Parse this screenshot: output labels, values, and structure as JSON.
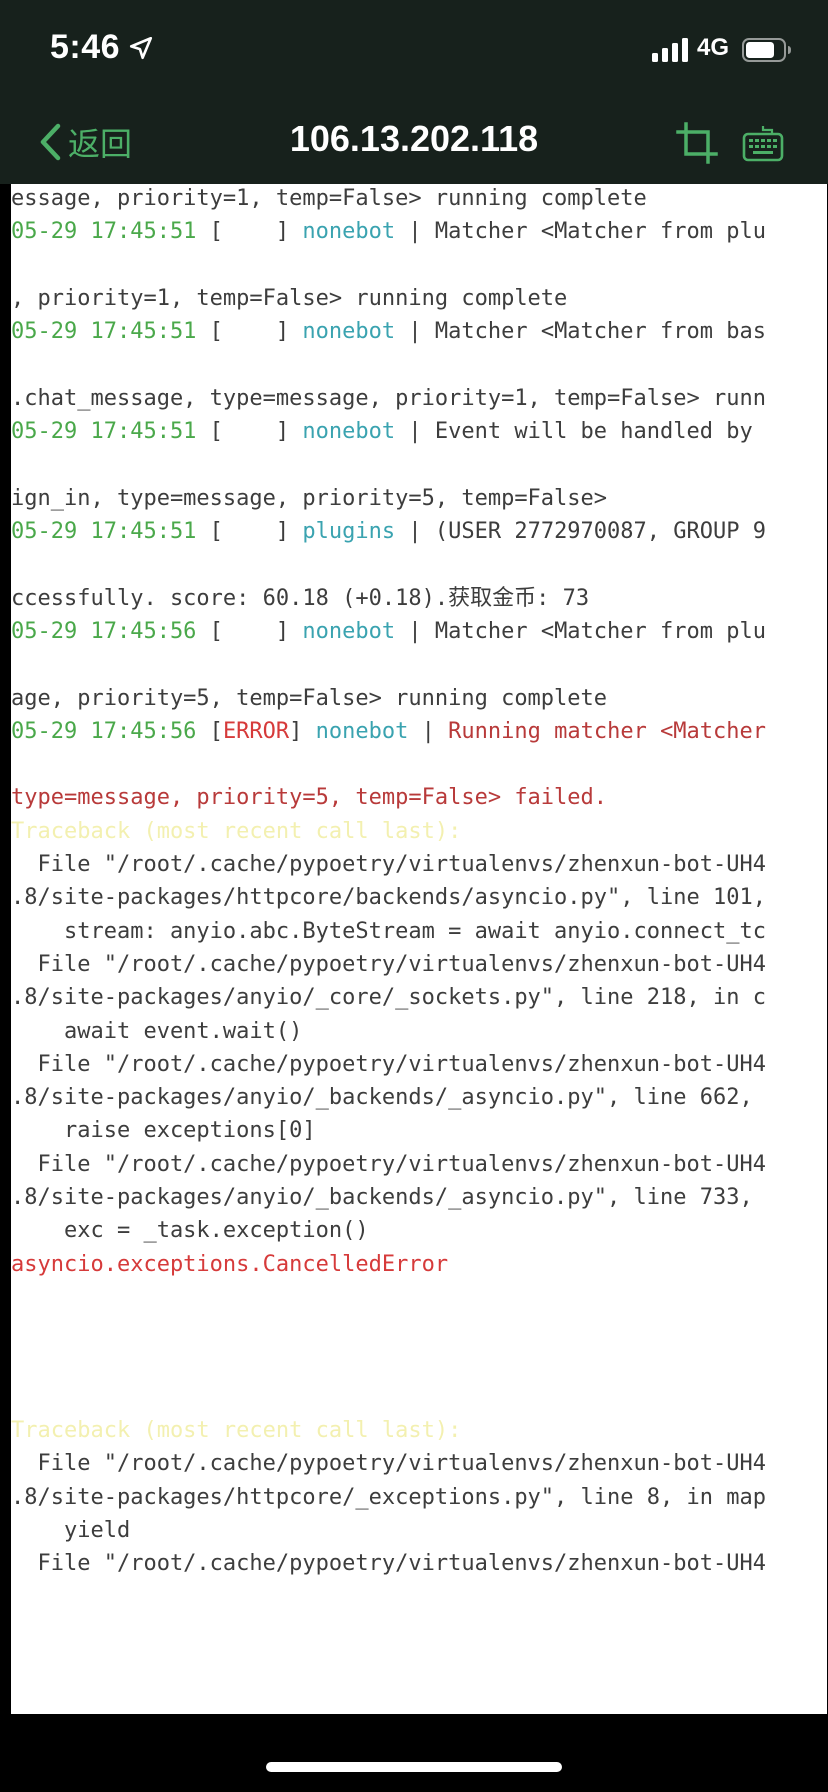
{
  "status_bar": {
    "time": "5:46",
    "network": "4G",
    "icons": [
      "location-arrow-icon",
      "cellular-signal-icon",
      "battery-icon"
    ]
  },
  "nav": {
    "back_label": "返回",
    "title": "106.13.202.118",
    "icons": [
      "chevron-left-icon",
      "crop-icon",
      "keyboard-icon"
    ]
  },
  "colors": {
    "nav_background": "#17211c",
    "accent_green": "#4caf67",
    "log_timestamp": "#4aa84a",
    "log_module": "#3aa3b0",
    "log_error": "#d63a3a",
    "log_traceback": "#f3f0b0",
    "log_text": "#3d3d3d"
  },
  "terminal": {
    "lines": [
      {
        "segments": [
          {
            "t": "essage, priority=1, temp=False> running complete",
            "c": "gray"
          }
        ]
      },
      {
        "segments": [
          {
            "t": "05-29 17:45:51",
            "c": "green"
          },
          {
            "t": " [    ] ",
            "c": "gray"
          },
          {
            "t": "nonebot",
            "c": "cyan"
          },
          {
            "t": " | Matcher <Matcher from plu",
            "c": "gray"
          }
        ]
      },
      {
        "segments": []
      },
      {
        "segments": [
          {
            "t": ", priority=1, temp=False> running complete",
            "c": "gray"
          }
        ]
      },
      {
        "segments": [
          {
            "t": "05-29 17:45:51",
            "c": "green"
          },
          {
            "t": " [    ] ",
            "c": "gray"
          },
          {
            "t": "nonebot",
            "c": "cyan"
          },
          {
            "t": " | Matcher <Matcher from bas",
            "c": "gray"
          }
        ]
      },
      {
        "segments": []
      },
      {
        "segments": [
          {
            "t": ".chat_message, type=message, priority=1, temp=False> runn",
            "c": "gray"
          }
        ]
      },
      {
        "segments": [
          {
            "t": "05-29 17:45:51",
            "c": "green"
          },
          {
            "t": " [    ] ",
            "c": "gray"
          },
          {
            "t": "nonebot",
            "c": "cyan"
          },
          {
            "t": " | Event will be handled by",
            "c": "gray"
          }
        ]
      },
      {
        "segments": []
      },
      {
        "segments": [
          {
            "t": "ign_in, type=message, priority=5, temp=False>",
            "c": "gray"
          }
        ]
      },
      {
        "segments": [
          {
            "t": "05-29 17:45:51",
            "c": "green"
          },
          {
            "t": " [    ] ",
            "c": "gray"
          },
          {
            "t": "plugins",
            "c": "cyan"
          },
          {
            "t": " | (USER 2772970087, GROUP 9",
            "c": "gray"
          }
        ]
      },
      {
        "segments": []
      },
      {
        "segments": [
          {
            "t": "ccessfully. score: 60.18 (+0.18).获取金币: 73",
            "c": "gray"
          }
        ]
      },
      {
        "segments": [
          {
            "t": "05-29 17:45:56",
            "c": "green"
          },
          {
            "t": " [    ] ",
            "c": "gray"
          },
          {
            "t": "nonebot",
            "c": "cyan"
          },
          {
            "t": " | Matcher <Matcher from plu",
            "c": "gray"
          }
        ]
      },
      {
        "segments": []
      },
      {
        "segments": [
          {
            "t": "age, priority=5, temp=False> running complete",
            "c": "gray"
          }
        ]
      },
      {
        "segments": [
          {
            "t": "05-29 17:45:56",
            "c": "green"
          },
          {
            "t": " [",
            "c": "gray"
          },
          {
            "t": "ERROR",
            "c": "red"
          },
          {
            "t": "] ",
            "c": "gray"
          },
          {
            "t": "nonebot",
            "c": "cyan"
          },
          {
            "t": " | ",
            "c": "gray"
          },
          {
            "t": "Running matcher <Matcher",
            "c": "darkred"
          }
        ]
      },
      {
        "segments": []
      },
      {
        "segments": [
          {
            "t": "type=message, priority=5, temp=False> failed.",
            "c": "darkred"
          }
        ]
      },
      {
        "segments": [
          {
            "t": "Traceback (most recent call last):",
            "c": "yellow"
          }
        ]
      },
      {
        "segments": [
          {
            "t": "  File \"/root/.cache/pypoetry/virtualenvs/zhenxun-bot-UH4",
            "c": "gray"
          }
        ]
      },
      {
        "segments": [
          {
            "t": ".8/site-packages/httpcore/backends/asyncio.py\", line 101,",
            "c": "gray"
          }
        ]
      },
      {
        "segments": [
          {
            "t": "    stream: anyio.abc.ByteStream = await anyio.connect_tc",
            "c": "gray"
          }
        ]
      },
      {
        "segments": [
          {
            "t": "  File \"/root/.cache/pypoetry/virtualenvs/zhenxun-bot-UH4",
            "c": "gray"
          }
        ]
      },
      {
        "segments": [
          {
            "t": ".8/site-packages/anyio/_core/_sockets.py\", line 218, in c",
            "c": "gray"
          }
        ]
      },
      {
        "segments": [
          {
            "t": "    await event.wait()",
            "c": "gray"
          }
        ]
      },
      {
        "segments": [
          {
            "t": "  File \"/root/.cache/pypoetry/virtualenvs/zhenxun-bot-UH4",
            "c": "gray"
          }
        ]
      },
      {
        "segments": [
          {
            "t": ".8/site-packages/anyio/_backends/_asyncio.py\", line 662,",
            "c": "gray"
          }
        ]
      },
      {
        "segments": [
          {
            "t": "    raise exceptions[0]",
            "c": "gray"
          }
        ]
      },
      {
        "segments": [
          {
            "t": "  File \"/root/.cache/pypoetry/virtualenvs/zhenxun-bot-UH4",
            "c": "gray"
          }
        ]
      },
      {
        "segments": [
          {
            "t": ".8/site-packages/anyio/_backends/_asyncio.py\", line 733,",
            "c": "gray"
          }
        ]
      },
      {
        "segments": [
          {
            "t": "    exc = _task.exception()",
            "c": "gray"
          }
        ]
      },
      {
        "segments": [
          {
            "t": "asyncio.exceptions.CancelledError",
            "c": "red"
          }
        ]
      },
      {
        "segments": []
      },
      {
        "segments": []
      },
      {
        "segments": []
      },
      {
        "segments": []
      },
      {
        "segments": [
          {
            "t": "Traceback (most recent call last):",
            "c": "yellow"
          }
        ]
      },
      {
        "segments": [
          {
            "t": "  File \"/root/.cache/pypoetry/virtualenvs/zhenxun-bot-UH4",
            "c": "gray"
          }
        ]
      },
      {
        "segments": [
          {
            "t": ".8/site-packages/httpcore/_exceptions.py\", line 8, in map",
            "c": "gray"
          }
        ]
      },
      {
        "segments": [
          {
            "t": "    yield",
            "c": "gray"
          }
        ]
      },
      {
        "segments": [
          {
            "t": "  File \"/root/.cache/pypoetry/virtualenvs/zhenxun-bot-UH4",
            "c": "gray"
          }
        ]
      }
    ]
  }
}
